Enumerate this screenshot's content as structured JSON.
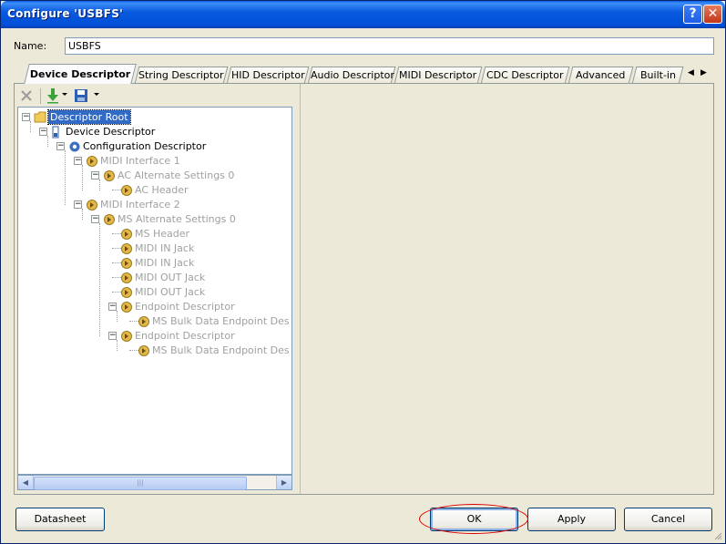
{
  "window": {
    "title": "Configure 'USBFS'",
    "help_label": "?",
    "close_label": "✕"
  },
  "name_field": {
    "label": "Name:",
    "value": "USBFS"
  },
  "tabs": [
    {
      "label": "Device Descriptor",
      "active": true
    },
    {
      "label": "String Descriptor"
    },
    {
      "label": "HID Descriptor"
    },
    {
      "label": "Audio Descriptor"
    },
    {
      "label": "MIDI Descriptor"
    },
    {
      "label": "CDC Descriptor"
    },
    {
      "label": "Advanced"
    },
    {
      "label": "Built-in"
    }
  ],
  "tab_scroll": {
    "left": "◀",
    "right": "▶"
  },
  "toolbar": {
    "delete_icon": "x-icon",
    "import_icon": "arrow-down-icon",
    "save_icon": "floppy-icon"
  },
  "tree": [
    {
      "label": "Descriptor Root",
      "level": 0,
      "icon": "folder-icon",
      "selected": true,
      "expanded": true
    },
    {
      "label": "Device Descriptor",
      "level": 1,
      "icon": "device-icon",
      "expanded": true
    },
    {
      "label": "Configuration Descriptor",
      "level": 2,
      "icon": "gear-icon",
      "expanded": true
    },
    {
      "label": "MIDI Interface 1",
      "level": 3,
      "icon": "speaker-icon",
      "dim": true,
      "expanded": true
    },
    {
      "label": "AC Alternate Settings 0",
      "level": 4,
      "icon": "speaker-icon",
      "dim": true,
      "expanded": true
    },
    {
      "label": "AC Header",
      "level": 5,
      "icon": "speaker-icon",
      "dim": true
    },
    {
      "label": "MIDI Interface 2",
      "level": 3,
      "icon": "speaker-icon",
      "dim": true,
      "expanded": true
    },
    {
      "label": "MS Alternate Settings 0",
      "level": 4,
      "icon": "speaker-icon",
      "dim": true,
      "expanded": true
    },
    {
      "label": "MS Header",
      "level": 5,
      "icon": "speaker-icon",
      "dim": true
    },
    {
      "label": "MIDI IN Jack",
      "level": 5,
      "icon": "speaker-icon",
      "dim": true
    },
    {
      "label": "MIDI IN Jack",
      "level": 5,
      "icon": "speaker-icon",
      "dim": true
    },
    {
      "label": "MIDI OUT Jack",
      "level": 5,
      "icon": "speaker-icon",
      "dim": true
    },
    {
      "label": "MIDI OUT Jack",
      "level": 5,
      "icon": "speaker-icon",
      "dim": true
    },
    {
      "label": "Endpoint Descriptor",
      "level": 5,
      "icon": "speaker-icon",
      "dim": true,
      "expanded": true
    },
    {
      "label": "MS Bulk Data Endpoint Des",
      "level": 6,
      "icon": "speaker-icon",
      "dim": true
    },
    {
      "label": "Endpoint Descriptor",
      "level": 5,
      "icon": "speaker-icon",
      "dim": true,
      "expanded": true
    },
    {
      "label": "MS Bulk Data Endpoint Des",
      "level": 6,
      "icon": "speaker-icon",
      "dim": true
    }
  ],
  "scrollbar": {
    "left_arrow": "◀",
    "right_arrow": "▶",
    "grip": "|||"
  },
  "buttons": {
    "datasheet": "Datasheet",
    "ok": "OK",
    "apply": "Apply",
    "cancel": "Cancel"
  },
  "colors": {
    "title_bar": "#0054e3",
    "selection": "#316ac5",
    "annotation_ring": "#dd0000"
  }
}
